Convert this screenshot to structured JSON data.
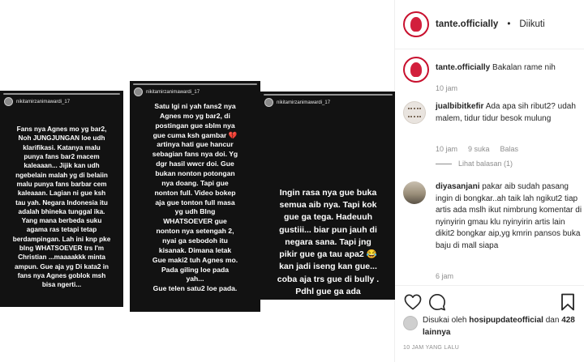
{
  "stories": [
    {
      "username": "nikitamirzanimawardi_17",
      "text": "Fans nya Agnes mo yg bar2,\nNoh JUNGJUNGAN loe udh\nklarifikasi. Katanya malu\npunya fans bar2 macem\nkaleaaan... Jijik kan udh\nngebelain malah yg di belaiin\nmalu punya fans barbar cem\nkaleaaan. Lagian ni gue ksh\ntau yah. Negara Indonesia itu\nadalah bhineka tunggal ika.\nYang mana berbeda suku\nagama ras tetapi tetap\nberdampingan. Lah ini knp pke\nblng WHATSOEVER trs I'm\nChristian ...maaaakkk minta\nampun. Gue aja yg Di kata2 in\nfans nya Agnes goblok msh\nbisa ngerti..."
    },
    {
      "username": "nikitamirzanimawardi_17",
      "text": "Satu lgi ni yah fans2 nya\nAgnes mo yg bar2, di\npostingan gue sblm nya\ngue cuma ksh gambar 💔\nartinya hati gue hancur\nsebagian fans nya doi. Yg\ndgr hasil wwcr doi. Gue\nbukan nonton potongan\nnya doang. Tapi gue\nnonton full. Video bokep\naja gue tonton full masa\nyg udh Blng\nWHATSOEVER gue\nnonton nya setengah 2,\nnyai ga sebodoh itu\nkisanak. Dimana letak\nGue maki2 tuh Agnes mo.\nPada giling loe pada\nyah...\nGue telen satu2 loe pada."
    },
    {
      "username": "nikitamirzanimawardi_17",
      "text": "Ingin rasa nya gue buka\nsemua aib  nya. Tapi kok\ngue ga tega. Hadeuuh\ngustiii... biar pun jauh di\nnegara sana. Tapi jng\npikir gue ga tau apa2 😂\nkan jadi iseng kan gue...\ncoba aja trs gue di bully .\nPdhl gue ga ada\nmenghina dll. Cus gue\ntungguin"
    }
  ],
  "post": {
    "author": "tante.officially",
    "separator": "•",
    "follow_status": "Diikuti"
  },
  "comments": [
    {
      "user": "tante.officially",
      "text": "Bakalan rame nih",
      "time": "10 jam"
    },
    {
      "user": "jualbibitkefir",
      "text": "Ada apa sih ribut2? udah malem, tidur tidur besok mulung",
      "time": "10 jam",
      "likes": "9 suka",
      "reply": "Balas",
      "view_replies": "Lihat balasan (1)"
    },
    {
      "user": "diyasanjani",
      "text": "pakar aib sudah pasang ingin di bongkar..ah taik lah ngikut2 tiap artis ada mslh ikut nimbrung komentar di nyinyirin gmau klu nyinyirin artis lain dikit2 bongkar aip,yg kmrin pansos buka baju di mall siapa",
      "time": "6 jam"
    }
  ],
  "footer": {
    "liked_prefix": "Disukai oleh",
    "liked_user": "hosipupdateofficial",
    "liked_and": "dan",
    "liked_count": "428 lainnya",
    "time_ago": "10 JAM YANG LALU"
  },
  "icons": [
    "heart-icon",
    "comment-icon",
    "bookmark-icon"
  ],
  "colors": {
    "brand_red": "#c8102e",
    "meta_gray": "#8e8e8e",
    "text": "#262626"
  }
}
